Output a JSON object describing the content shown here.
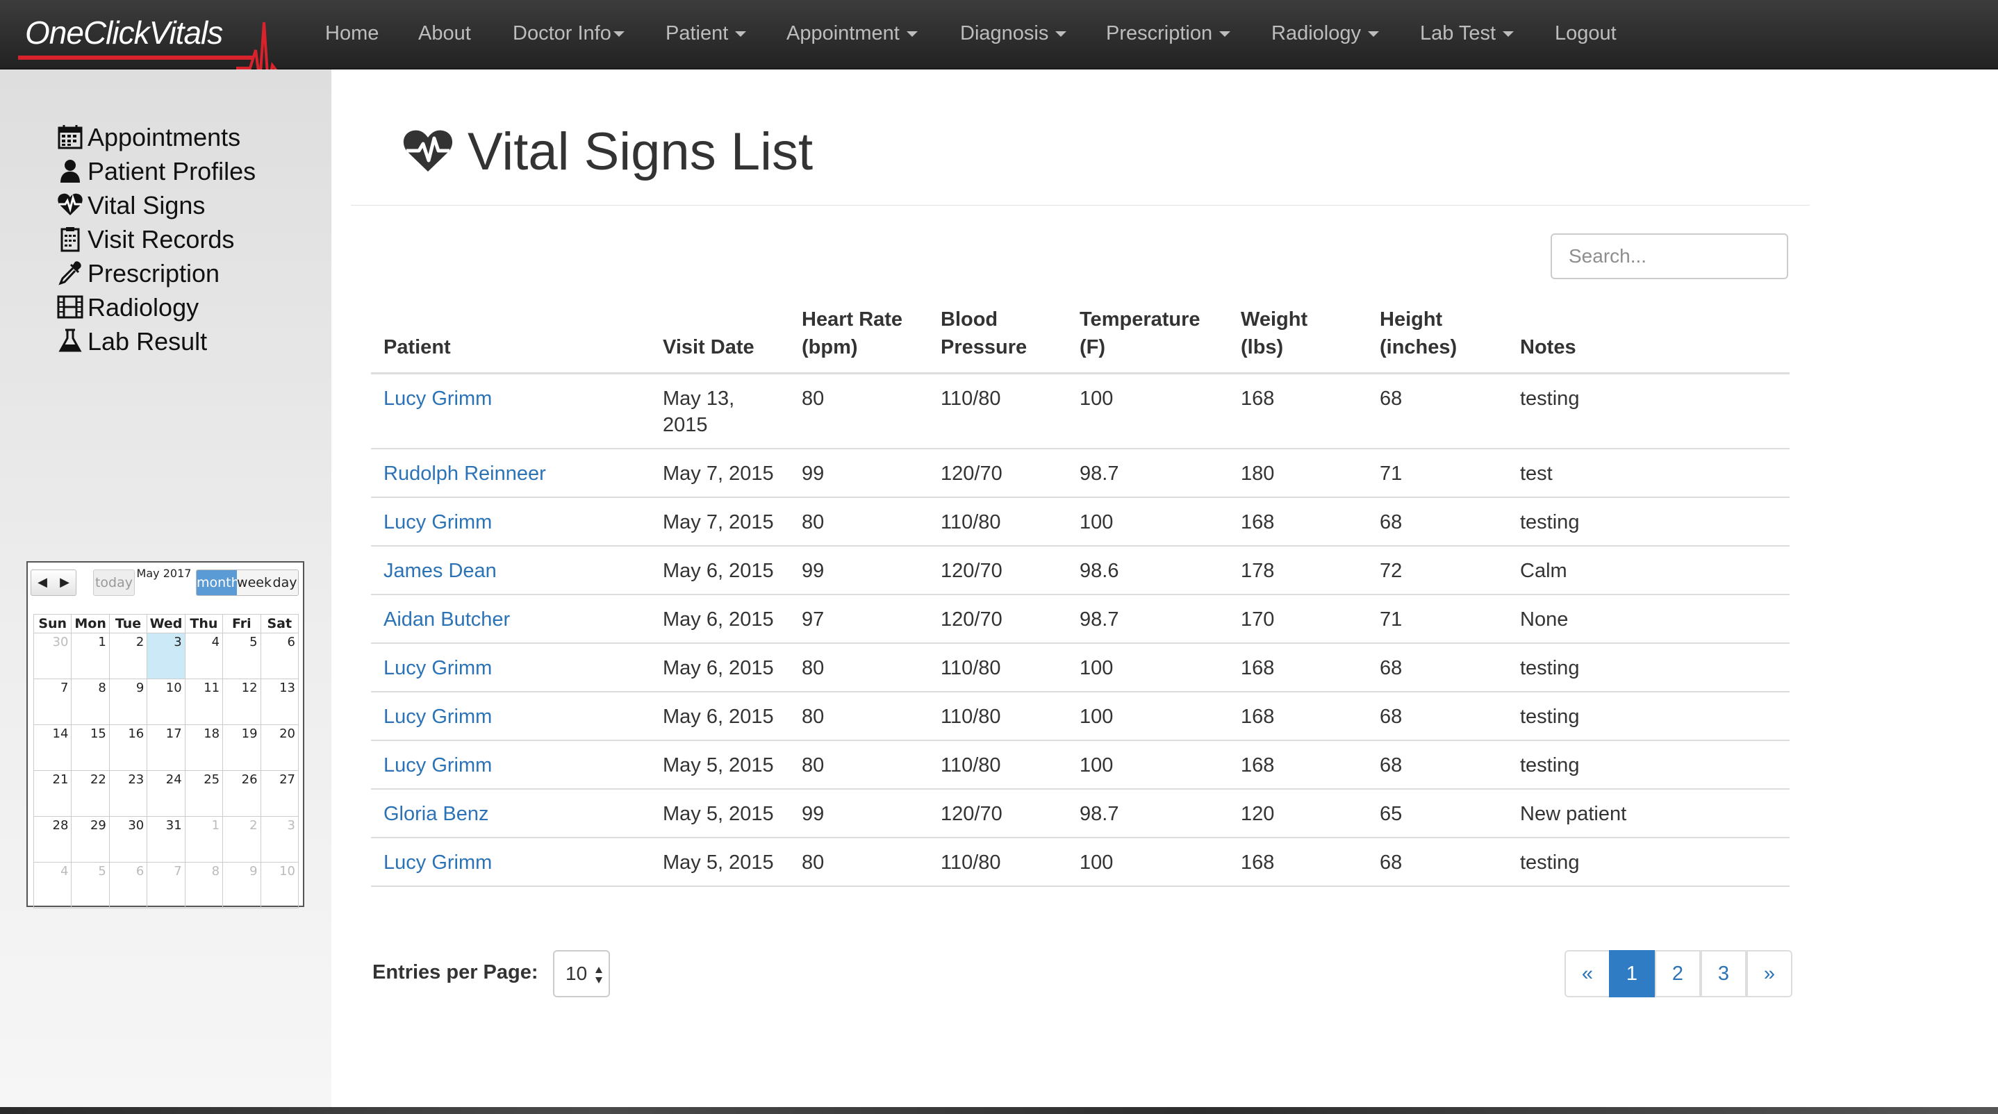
{
  "brand": "OneClickVitals",
  "nav": [
    {
      "label": "Home",
      "dropdown": false
    },
    {
      "label": "About",
      "dropdown": false
    },
    {
      "label": "Doctor Info",
      "dropdown": true
    },
    {
      "label": "Patient",
      "dropdown": true
    },
    {
      "label": "Appointment",
      "dropdown": true
    },
    {
      "label": "Diagnosis",
      "dropdown": true
    },
    {
      "label": "Prescription",
      "dropdown": true
    },
    {
      "label": "Radiology",
      "dropdown": true
    },
    {
      "label": "Lab Test",
      "dropdown": true
    },
    {
      "label": "Logout",
      "dropdown": false
    }
  ],
  "sidebar": [
    {
      "label": "Appointments",
      "icon": "calendar-icon"
    },
    {
      "label": "Patient Profiles",
      "icon": "user-icon"
    },
    {
      "label": "Vital Signs",
      "icon": "heartbeat-icon"
    },
    {
      "label": "Visit Records",
      "icon": "clipboard-icon"
    },
    {
      "label": "Prescription",
      "icon": "eyedropper-icon"
    },
    {
      "label": "Radiology",
      "icon": "film-icon"
    },
    {
      "label": "Lab Result",
      "icon": "flask-icon"
    }
  ],
  "calendar": {
    "title": "May 2017",
    "today_label": "today",
    "views": [
      "month",
      "week",
      "day"
    ],
    "active_view": "month",
    "weekdays": [
      "Sun",
      "Mon",
      "Tue",
      "Wed",
      "Thu",
      "Fri",
      "Sat"
    ],
    "weeks": [
      [
        {
          "d": "30",
          "o": true
        },
        {
          "d": "1"
        },
        {
          "d": "2"
        },
        {
          "d": "3",
          "t": true
        },
        {
          "d": "4"
        },
        {
          "d": "5"
        },
        {
          "d": "6"
        }
      ],
      [
        {
          "d": "7"
        },
        {
          "d": "8"
        },
        {
          "d": "9"
        },
        {
          "d": "10"
        },
        {
          "d": "11"
        },
        {
          "d": "12"
        },
        {
          "d": "13"
        }
      ],
      [
        {
          "d": "14"
        },
        {
          "d": "15"
        },
        {
          "d": "16"
        },
        {
          "d": "17"
        },
        {
          "d": "18"
        },
        {
          "d": "19"
        },
        {
          "d": "20"
        }
      ],
      [
        {
          "d": "21"
        },
        {
          "d": "22"
        },
        {
          "d": "23"
        },
        {
          "d": "24"
        },
        {
          "d": "25"
        },
        {
          "d": "26"
        },
        {
          "d": "27"
        }
      ],
      [
        {
          "d": "28"
        },
        {
          "d": "29"
        },
        {
          "d": "30"
        },
        {
          "d": "31"
        },
        {
          "d": "1",
          "o": true
        },
        {
          "d": "2",
          "o": true
        },
        {
          "d": "3",
          "o": true
        }
      ],
      [
        {
          "d": "4",
          "o": true
        },
        {
          "d": "5",
          "o": true
        },
        {
          "d": "6",
          "o": true
        },
        {
          "d": "7",
          "o": true
        },
        {
          "d": "8",
          "o": true
        },
        {
          "d": "9",
          "o": true
        },
        {
          "d": "10",
          "o": true
        }
      ]
    ]
  },
  "page": {
    "title": "Vital Signs List",
    "search_placeholder": "Search..."
  },
  "table": {
    "columns": [
      {
        "key": "patient",
        "l1": "Patient",
        "l2": ""
      },
      {
        "key": "date",
        "l1": "Visit Date",
        "l2": ""
      },
      {
        "key": "hr",
        "l1": "Heart Rate",
        "l2": "(bpm)"
      },
      {
        "key": "bp",
        "l1": "Blood",
        "l2": "Pressure"
      },
      {
        "key": "temp",
        "l1": "Temperature",
        "l2": "(F)"
      },
      {
        "key": "weight",
        "l1": "Weight (lbs)",
        "l2": ""
      },
      {
        "key": "height",
        "l1": "Height",
        "l2": "(inches)"
      },
      {
        "key": "notes",
        "l1": "Notes",
        "l2": ""
      }
    ],
    "rows": [
      {
        "patient": "Lucy Grimm",
        "date": "May 13, 2015",
        "hr": "80",
        "bp": "110/80",
        "temp": "100",
        "weight": "168",
        "height": "68",
        "notes": "testing"
      },
      {
        "patient": "Rudolph Reinneer",
        "date": "May 7, 2015",
        "hr": "99",
        "bp": "120/70",
        "temp": "98.7",
        "weight": "180",
        "height": "71",
        "notes": "test"
      },
      {
        "patient": "Lucy Grimm",
        "date": "May 7, 2015",
        "hr": "80",
        "bp": "110/80",
        "temp": "100",
        "weight": "168",
        "height": "68",
        "notes": "testing"
      },
      {
        "patient": "James Dean",
        "date": "May 6, 2015",
        "hr": "99",
        "bp": "120/70",
        "temp": "98.6",
        "weight": "178",
        "height": "72",
        "notes": "Calm"
      },
      {
        "patient": "Aidan Butcher",
        "date": "May 6, 2015",
        "hr": "97",
        "bp": "120/70",
        "temp": "98.7",
        "weight": "170",
        "height": "71",
        "notes": "None"
      },
      {
        "patient": "Lucy Grimm",
        "date": "May 6, 2015",
        "hr": "80",
        "bp": "110/80",
        "temp": "100",
        "weight": "168",
        "height": "68",
        "notes": "testing"
      },
      {
        "patient": "Lucy Grimm",
        "date": "May 6, 2015",
        "hr": "80",
        "bp": "110/80",
        "temp": "100",
        "weight": "168",
        "height": "68",
        "notes": "testing"
      },
      {
        "patient": "Lucy Grimm",
        "date": "May 5, 2015",
        "hr": "80",
        "bp": "110/80",
        "temp": "100",
        "weight": "168",
        "height": "68",
        "notes": "testing"
      },
      {
        "patient": "Gloria Benz",
        "date": "May 5, 2015",
        "hr": "99",
        "bp": "120/70",
        "temp": "98.7",
        "weight": "120",
        "height": "65",
        "notes": "New patient"
      },
      {
        "patient": "Lucy Grimm",
        "date": "May 5, 2015",
        "hr": "80",
        "bp": "110/80",
        "temp": "100",
        "weight": "168",
        "height": "68",
        "notes": "testing"
      }
    ]
  },
  "footer": {
    "entries_label": "Entries per Page:",
    "entries_value": "10",
    "pagination": {
      "prev": "«",
      "pages": [
        "1",
        "2",
        "3"
      ],
      "next": "»",
      "active": "1"
    }
  },
  "colors": {
    "brand_red": "#d9232c",
    "link": "#2b73b6",
    "active_page": "#2f7cc4",
    "calendar_today": "#cbe9f7",
    "calendar_active_view": "#5b9bd5"
  }
}
